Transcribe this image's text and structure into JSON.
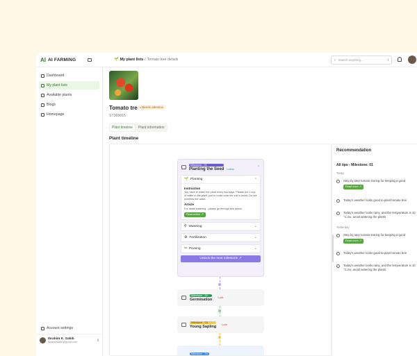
{
  "brand": {
    "logo": "AI",
    "name": "AI FARMING"
  },
  "breadcrumb": {
    "current": "My plant lists",
    "separator": "/",
    "sub": "Tomato tree details"
  },
  "search": {
    "placeholder": "Search anything...",
    "shortcut": "/"
  },
  "sidebar": {
    "items": [
      {
        "label": "Dashboard",
        "icon": "dashboard-icon"
      },
      {
        "label": "My plant lists",
        "icon": "sprout-icon",
        "active": true
      },
      {
        "label": "Available plants",
        "icon": "plant-icon"
      },
      {
        "label": "Blogs",
        "icon": "blog-icon"
      },
      {
        "label": "Homepage",
        "icon": "home-icon"
      }
    ],
    "settings": "Account settings",
    "user": {
      "name": "Ibrahim K. Sakib",
      "email": "ibrahimsakib@gmail.com"
    }
  },
  "plant": {
    "name": "Tomato tree",
    "status": "Needs attention",
    "code": "ST365015",
    "tabs": [
      "Plant timeline",
      "Plant information"
    ]
  },
  "timeline": {
    "heading": "Plant timeline",
    "milestone1": {
      "tag": "Milestone - 01",
      "title": "Planting the Seed",
      "state": "Latest",
      "tasks": {
        "planting": "Planting",
        "instruction_heading": "Instruction",
        "instruction_text": "You have to water the plant every two days. Please put 1 cup of water in the plant, just to make sure the soil is moist. Do not overflow the water.",
        "article_heading": "Article",
        "article_text": "For detail watering - please go through this article",
        "read_article": "Read article ↗",
        "watering": "Watering",
        "fertilization": "Fertilization",
        "pruning": "Pruning"
      },
      "unlock": "Unlock the next milestone ↗"
    },
    "milestone2": {
      "tag": "Milestone - 02",
      "title": "Germination",
      "state": "Lock"
    },
    "milestone3": {
      "tag": "Milestone - 03",
      "title": "Young Sapling",
      "state": "Lock"
    },
    "milestone4": {
      "tag": "Milestone - 04"
    }
  },
  "recommendation": {
    "title": "Recommendation",
    "subtitle": "All tips - Milestone: 01",
    "today": "Today",
    "yesterday": "Yesterday",
    "tip1": "Step by step tomato storing for keeping a good",
    "read_more": "Read more ↗",
    "tip2": "Today's weather looks good to plant tomato tree",
    "tip3": "Today's weather looks rainy, and the temperature is 10 °C.So, avoid watering the plants"
  },
  "colors": {
    "accent": "#2f7a2f",
    "milestone_purple": "#6d5bd0",
    "background": "#fef8e7"
  }
}
